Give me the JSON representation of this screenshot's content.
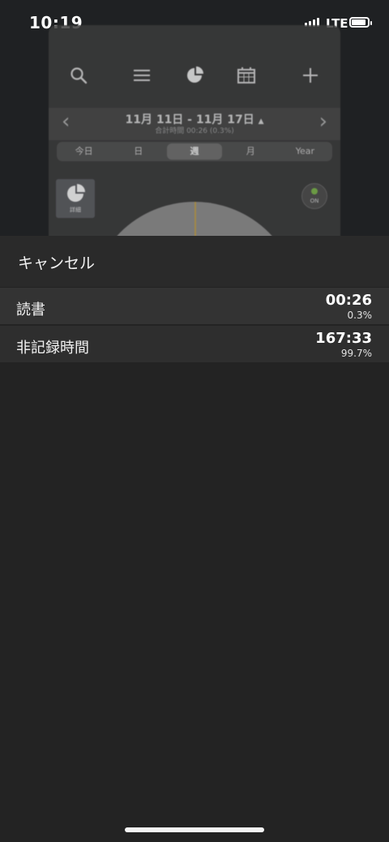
{
  "status_bar": {
    "time": "10:19",
    "network": "LTE",
    "battery_level": 0.9
  },
  "background_app": {
    "toolbar": {
      "icons": [
        "search-icon",
        "list-icon",
        "pie-chart-icon",
        "calendar-icon",
        "add-icon"
      ]
    },
    "date_range": "11月 11日 - 11月 17日",
    "total_time": "合計時間 00:26 (0.3%)",
    "tabs": [
      {
        "label": "今日",
        "active": false
      },
      {
        "label": "日",
        "active": false
      },
      {
        "label": "週",
        "active": true
      },
      {
        "label": "月",
        "active": false
      },
      {
        "label": "Year",
        "active": false
      }
    ],
    "detail_label": "詳細",
    "toggle_label": "ON"
  },
  "action_sheet": {
    "cancel_label": "キャンセル",
    "items": [
      {
        "label": "読書",
        "time": "00:26",
        "percent": "0.3%"
      },
      {
        "label": "非記録時間",
        "time": "167:33",
        "percent": "99.7%"
      }
    ]
  }
}
